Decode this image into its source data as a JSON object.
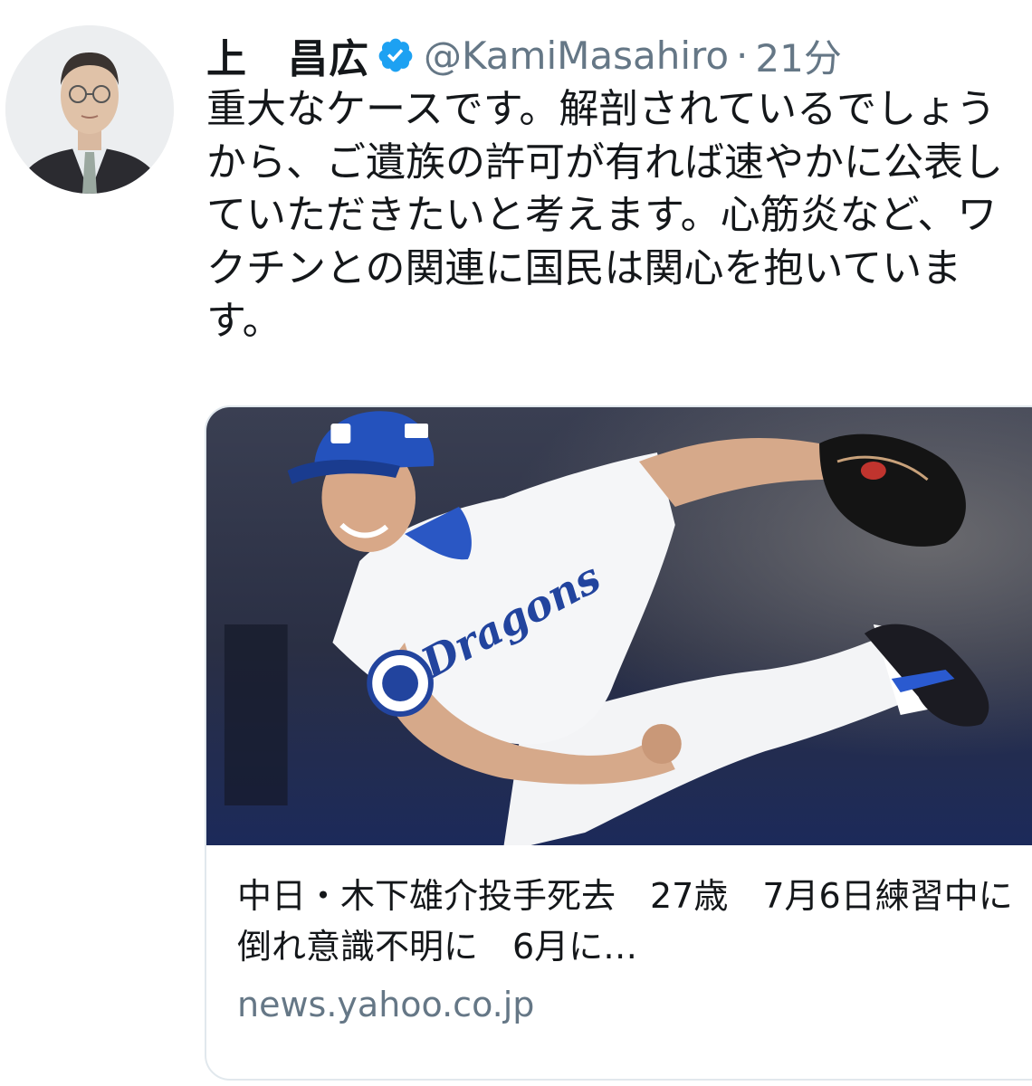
{
  "tweet": {
    "author_name": "上　昌広",
    "handle": "@KamiMasahiro",
    "separator": "·",
    "time": "21分",
    "text": "重大なケースです。解剖されているでしょうから、ご遺族の許可が有れば速やかに公表していただきたいと考えます。心筋炎など、ワクチンとの関連に国民は関心を抱いています。"
  },
  "link_card": {
    "title": "中日・木下雄介投手死去　27歳　7月6日練習中に倒れ意識不明に　6月に…",
    "domain": "news.yahoo.co.jp",
    "image_jersey_text": "Dragons"
  },
  "icons": {
    "verified": "verified-badge-icon",
    "avatar": "profile-photo"
  },
  "colors": {
    "verified_blue": "#1da1f2",
    "secondary_text": "#657786",
    "card_border": "#e1e8ed",
    "team_blue": "#1f4fa8"
  }
}
